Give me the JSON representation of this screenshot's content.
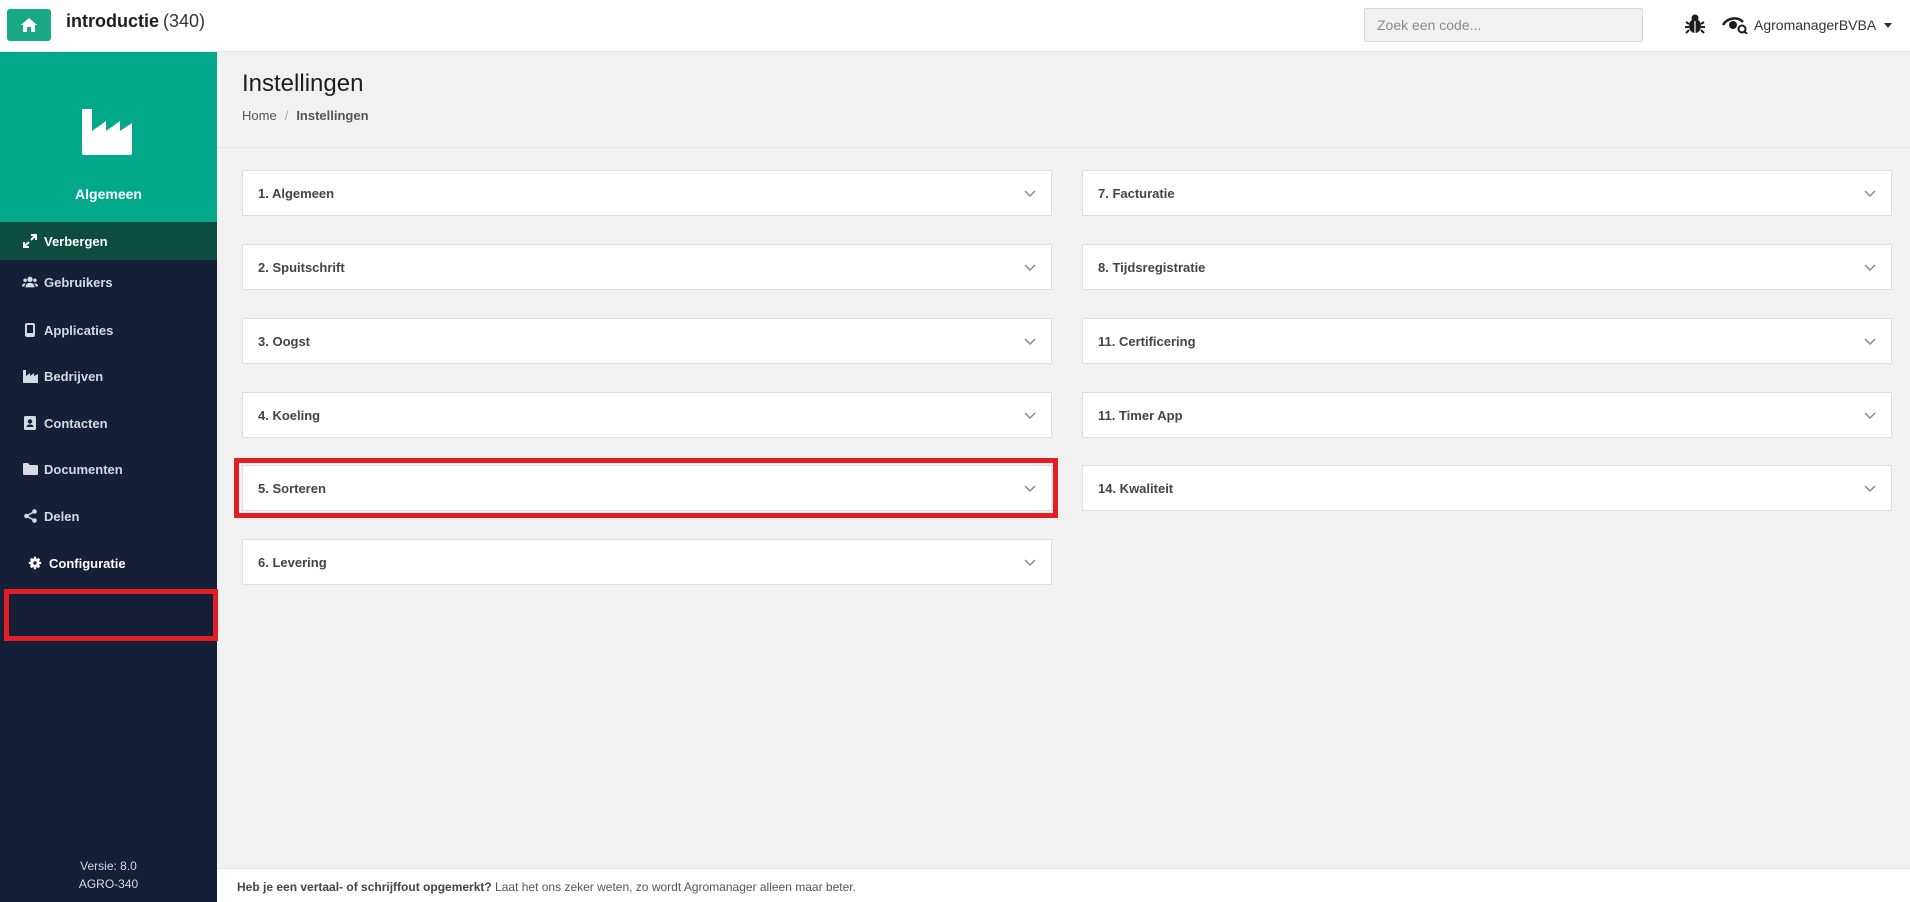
{
  "header": {
    "app_name": "introductie",
    "app_count": "(340)",
    "search_placeholder": "Zoek een code...",
    "user_name": "AgromanagerBVBA",
    "accent_color": "#1aa987"
  },
  "sidebar": {
    "title": "Algemeen",
    "hide_label": "Verbergen",
    "items": [
      {
        "label": "Gebruikers",
        "icon": "users-icon"
      },
      {
        "label": "Applicaties",
        "icon": "mobile-icon"
      },
      {
        "label": "Bedrijven",
        "icon": "factory-icon"
      },
      {
        "label": "Contacten",
        "icon": "contact-book-icon"
      },
      {
        "label": "Documenten",
        "icon": "folder-icon"
      },
      {
        "label": "Delen",
        "icon": "share-icon"
      },
      {
        "label": "Configuratie",
        "icon": "gear-icon"
      }
    ],
    "version": "Versie: 8.0",
    "build": "AGRO-340",
    "background_color": "#161f38",
    "header_color": "#01a98a"
  },
  "main": {
    "title": "Instellingen",
    "breadcrumb": {
      "home": "Home",
      "separator": "/",
      "current": "Instellingen"
    },
    "left_panels": [
      "1. Algemeen",
      "2. Spuitschrift",
      "3. Oogst",
      "4. Koeling",
      "5. Sorteren",
      "6. Levering"
    ],
    "right_panels": [
      "7. Facturatie",
      "8. Tijdsregistratie",
      "11. Certificering",
      "11. Timer App",
      "14. Kwaliteit"
    ]
  },
  "footer": {
    "bold_text": "Heb je een vertaal- of schrijffout opgemerkt?",
    "text": " Laat het ons zeker weten, zo wordt Agromanager alleen maar beter."
  },
  "highlight_color": "#e41e24"
}
